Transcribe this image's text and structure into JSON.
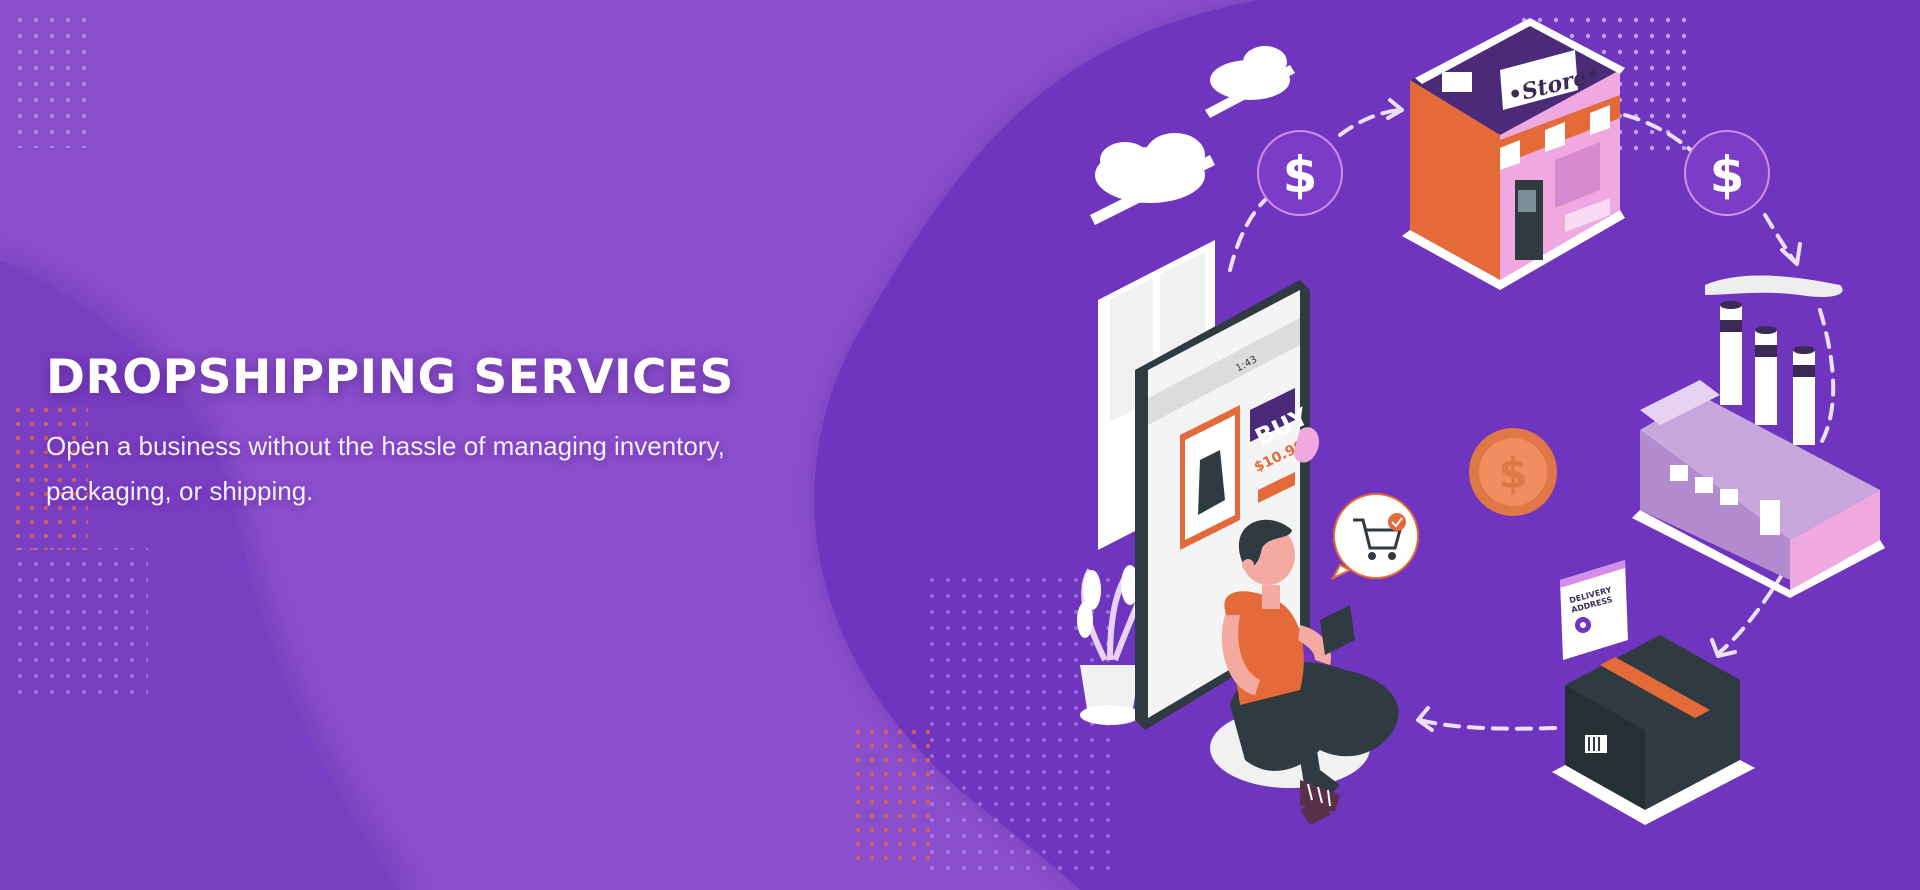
{
  "hero": {
    "title": "DROPSHIPPING SERVICES",
    "description": "Open a business without the hassle of managing inventory, packaging, or shipping."
  },
  "illustration": {
    "store_sign": "•Store•",
    "buy_label": "BUY",
    "price": "$10.99",
    "phone_time": "1:43",
    "delivery_label_line1": "DELIVERY",
    "delivery_label_line2": "ADDRESS",
    "currency_symbol": "$"
  },
  "colors": {
    "background": "#8a4dcb",
    "background_dark": "#6f35be",
    "accent_orange": "#e46a3a",
    "store_pink": "#f0a8e0",
    "phone_dark": "#2f3b40",
    "white": "#ffffff"
  }
}
